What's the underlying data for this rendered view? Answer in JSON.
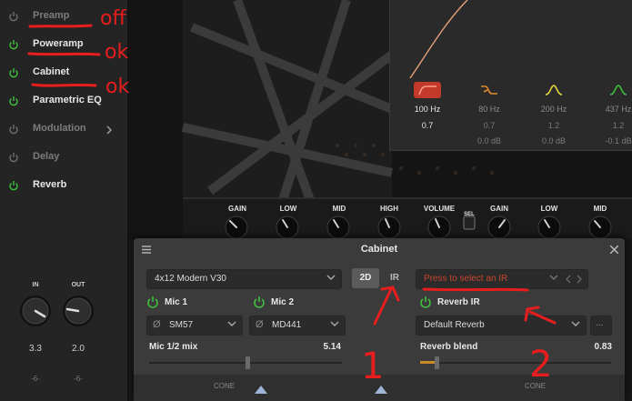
{
  "sidebar": {
    "items": [
      {
        "label": "Preamp",
        "on": false
      },
      {
        "label": "Poweramp",
        "on": true
      },
      {
        "label": "Cabinet",
        "on": true
      },
      {
        "label": "Parametric EQ",
        "on": true
      },
      {
        "label": "Modulation",
        "on": false,
        "chevron": "chevron-right-icon"
      },
      {
        "label": "Delay",
        "on": false
      },
      {
        "label": "Reverb",
        "on": true
      }
    ],
    "in_knob": {
      "caption": "IN",
      "value": "3.3",
      "sub": "-6-"
    },
    "out_knob": {
      "caption": "OUT",
      "value": "2.0",
      "sub": "-6-"
    }
  },
  "amp": {
    "knob_labels": [
      "GAIN",
      "LOW",
      "MID",
      "HIGH",
      "VOLUME",
      "SEL",
      "GAIN",
      "LOW",
      "MID"
    ]
  },
  "eq": {
    "bands": [
      {
        "freq": "100 Hz",
        "q": "0.7",
        "gain": "",
        "icon": "low-cut-icon",
        "active": true
      },
      {
        "freq": "80 Hz",
        "q": "0.7",
        "gain": "0.0 dB",
        "icon": "low-shelf-icon",
        "active": false
      },
      {
        "freq": "200 Hz",
        "q": "1.2",
        "gain": "0.0 dB",
        "icon": "bell-icon",
        "active": false
      },
      {
        "freq": "437 Hz",
        "q": "1.2",
        "gain": "-0.1 dB",
        "icon": "bell-icon",
        "active": false
      }
    ]
  },
  "cabinet": {
    "title": "Cabinet",
    "cab_select": "4x12 Modern V30",
    "mode_2d": "2D",
    "mode_ir": "IR",
    "ir_select": "Press to select an IR",
    "mic1": {
      "label": "Mic 1",
      "model": "SM57"
    },
    "mic2": {
      "label": "Mic 2",
      "model": "MD441"
    },
    "reverb_ir": {
      "label": "Reverb IR",
      "preset": "Default Reverb",
      "more": "..."
    },
    "mic_mix": {
      "label": "Mic 1/2 mix",
      "value": "5.14"
    },
    "reverb_blend": {
      "label": "Reverb blend",
      "value": "0.83"
    },
    "cone_left": "CONE",
    "cone_right": "CONE"
  },
  "annotations": {
    "preamp": "off",
    "poweramp": "ok",
    "cabinet": "ok",
    "num1": "1",
    "num2": "2"
  },
  "colors": {
    "power_on": "#3ec13e",
    "power_off": "#6e6e6e",
    "annotation_red": "#e81d1d",
    "ir_text": "#c8452f",
    "eq_curve": "#e3a07a",
    "blend_fill": "#c98a2a"
  }
}
